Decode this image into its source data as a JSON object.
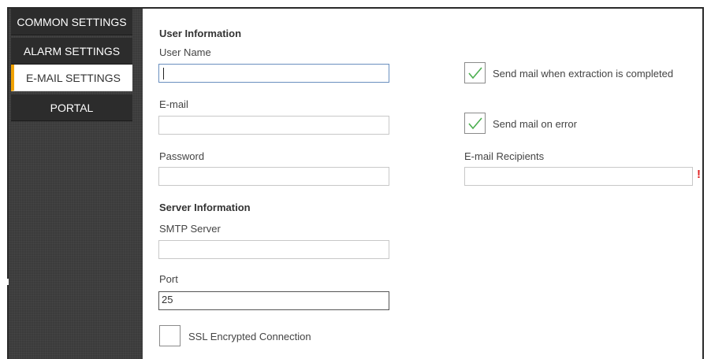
{
  "sidebar": {
    "items": [
      {
        "label": "COMMON SETTINGS"
      },
      {
        "label": "ALARM SETTINGS"
      },
      {
        "label": "E-MAIL SETTINGS"
      },
      {
        "label": "PORTAL"
      }
    ],
    "active_index": 2,
    "accent_color": "#f0a202"
  },
  "user_info": {
    "title": "User Information",
    "username_label": "User Name",
    "username_value": "",
    "email_label": "E-mail",
    "email_value": "",
    "password_label": "Password",
    "password_value": ""
  },
  "server_info": {
    "title": "Server Information",
    "smtp_label": "SMTP Server",
    "smtp_value": "",
    "port_label": "Port",
    "port_value": "25",
    "ssl_label": "SSL Encrypted Connection",
    "ssl_checked": false
  },
  "notifications": {
    "send_on_complete_label": "Send mail when extraction is completed",
    "send_on_complete_checked": true,
    "send_on_error_label": "Send mail on error",
    "send_on_error_checked": true,
    "recipients_label": "E-mail Recipients",
    "recipients_value": "",
    "recipients_warning": "!",
    "check_color": "#4caf50",
    "warning_color": "#e02020"
  }
}
